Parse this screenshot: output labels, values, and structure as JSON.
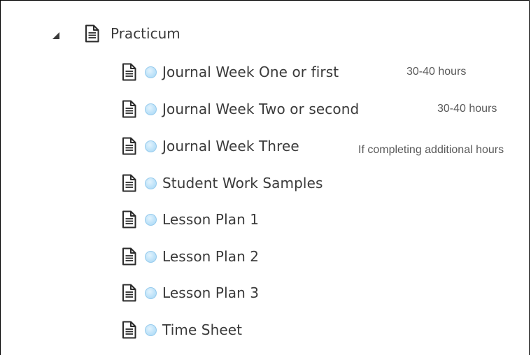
{
  "tree": {
    "parent": {
      "label": "Practicum",
      "expanded": true,
      "toggle_icon": "triangle-down-icon",
      "icon": "document-icon"
    },
    "items": [
      {
        "label": "Journal Week One or first",
        "icon": "document-icon",
        "status": "not-started-dot-icon",
        "note": "30-40 hours"
      },
      {
        "label": "Journal Week Two or second",
        "icon": "document-icon",
        "status": "not-started-dot-icon",
        "note": "30-40 hours"
      },
      {
        "label": "Journal Week Three",
        "icon": "document-icon",
        "status": "not-started-dot-icon",
        "note": "If completing additional hours"
      },
      {
        "label": "Student Work Samples",
        "icon": "document-icon",
        "status": "not-started-dot-icon",
        "note": ""
      },
      {
        "label": "Lesson Plan 1",
        "icon": "document-icon",
        "status": "not-started-dot-icon",
        "note": ""
      },
      {
        "label": "Lesson Plan 2",
        "icon": "document-icon",
        "status": "not-started-dot-icon",
        "note": ""
      },
      {
        "label": "Lesson Plan 3",
        "icon": "document-icon",
        "status": "not-started-dot-icon",
        "note": ""
      },
      {
        "label": "Time Sheet",
        "icon": "document-icon",
        "status": "not-started-dot-icon",
        "note": ""
      }
    ]
  },
  "colors": {
    "text": "#3a3a3a",
    "note_text": "#5a5a5a",
    "status_dot": "#bfe3f9",
    "icon": "#2b2b2b"
  }
}
